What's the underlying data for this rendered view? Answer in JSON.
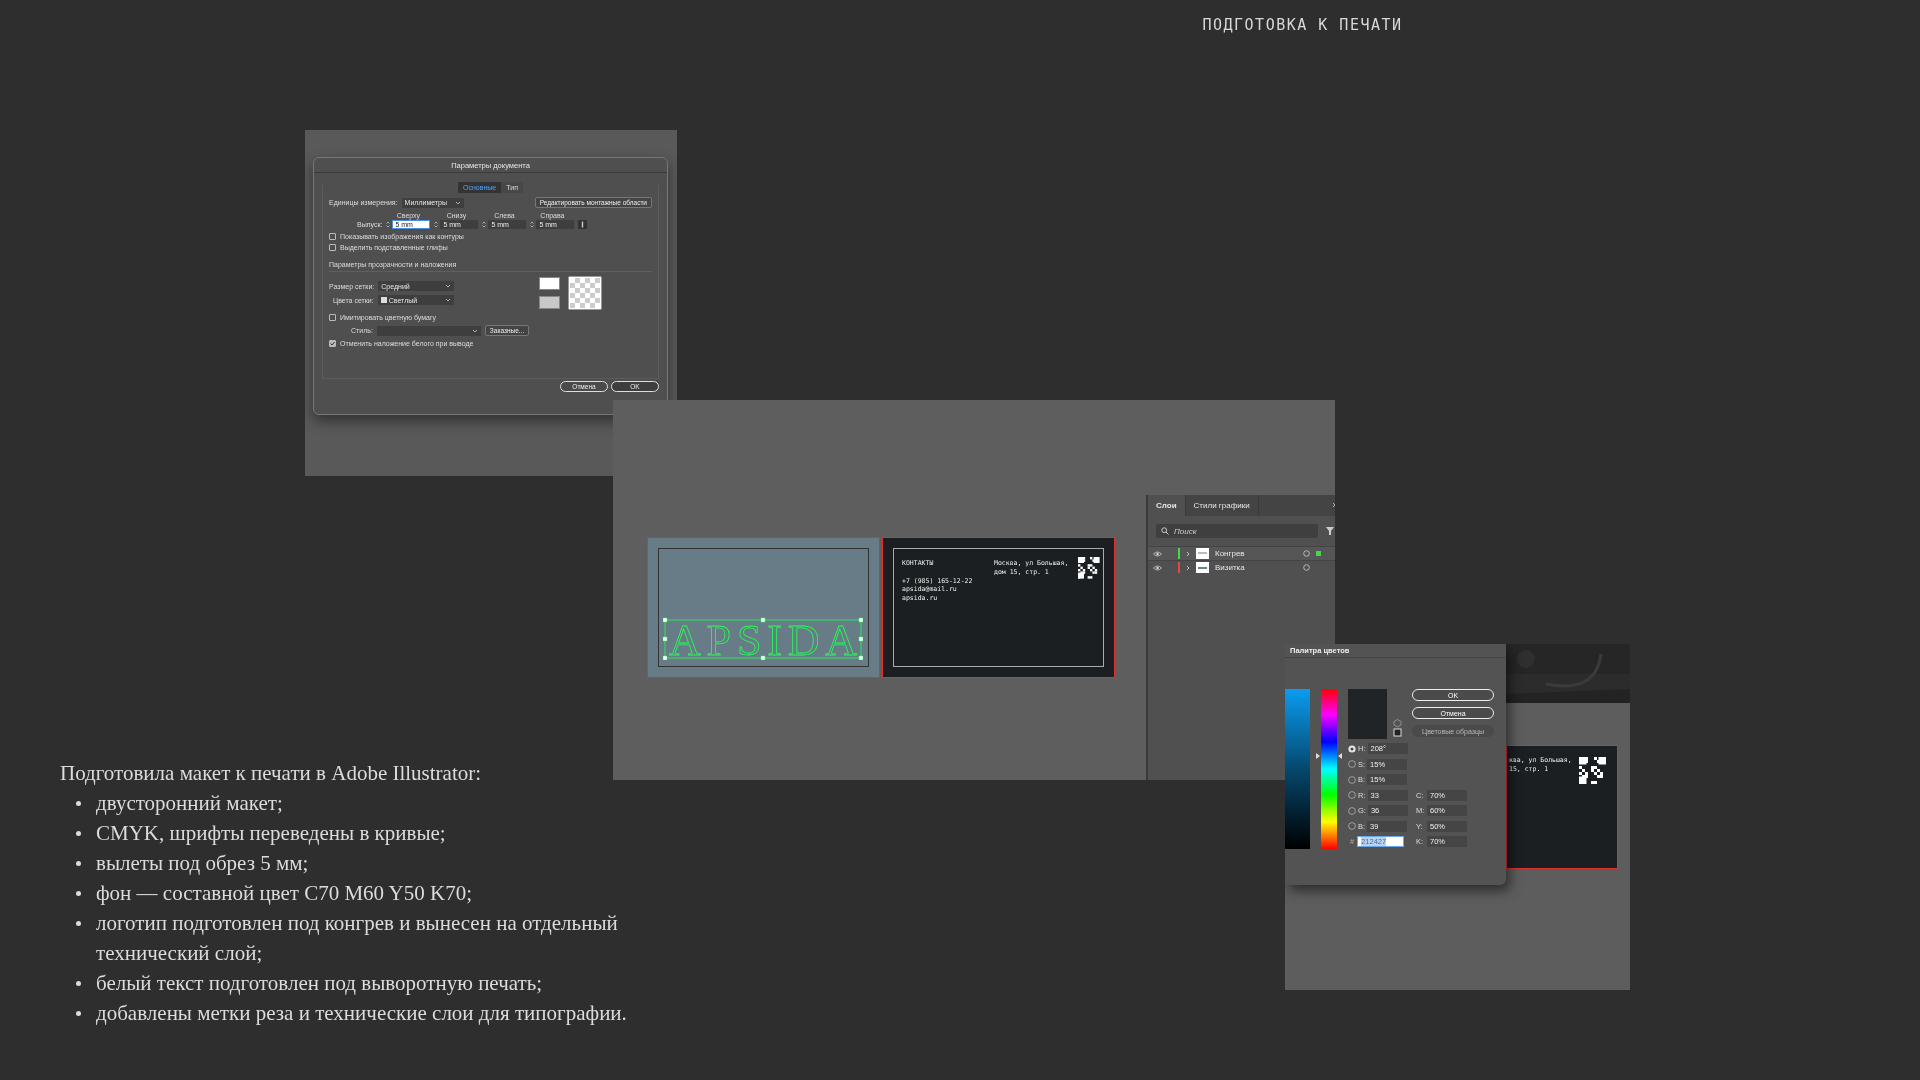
{
  "header": {
    "title": "ПОДГОТОВКА К ПЕЧАТИ"
  },
  "document_dialog": {
    "title": "Параметры документа",
    "tabs": [
      {
        "label": "Основные",
        "selected": true
      },
      {
        "label": "Тип",
        "selected": false
      }
    ],
    "units_label": "Единицы измерения:",
    "units_value": "Миллиметры",
    "edit_artboards_button": "Редактировать монтажные области",
    "bleed_label": "Выпуск:",
    "bleed": [
      {
        "label": "Сверху",
        "value": "5 mm",
        "focused": true
      },
      {
        "label": "Снизу",
        "value": "5 mm",
        "focused": false
      },
      {
        "label": "Слева",
        "value": "5 mm",
        "focused": false
      },
      {
        "label": "Справа",
        "value": "5 mm",
        "focused": false
      }
    ],
    "checkboxes": [
      {
        "label": "Показывать изображения как контуры",
        "checked": false
      },
      {
        "label": "Выделить подставленные глифы",
        "checked": false
      }
    ],
    "transparency_section": "Параметры прозрачности и наложения",
    "grid_size_label": "Размер сетки:",
    "grid_size_value": "Средний",
    "grid_colors_label": "Цвета сетки:",
    "grid_colors_value": "Светлый",
    "simulate_paper": {
      "label": "Имитировать цветную бумагу",
      "checked": false
    },
    "style_label": "Стиль:",
    "custom_button": "Заказные...",
    "discard_white": {
      "label": "Отменить наложение белого при выводе",
      "checked": true
    },
    "buttons": [
      "Отмена",
      "OK"
    ]
  },
  "artboards": {
    "logo_text": "APSIDA",
    "card": {
      "heading": "КОНТАКТЫ",
      "phone": "+7 (985) 165-12-22",
      "email": "apsida@mail.ru",
      "site": "apsida.ru",
      "address_lines": [
        "Москва, ул Большая,",
        "дом 15, стр. 1"
      ]
    }
  },
  "layers_panel": {
    "tabs": [
      {
        "label": "Слои",
        "selected": true
      },
      {
        "label": "Стили графики",
        "selected": false
      }
    ],
    "search": {
      "placeholder": "Поиск"
    },
    "layers": [
      {
        "name": "Конгрев",
        "color": "#3ddc4a",
        "selected": true
      },
      {
        "name": "Визитка",
        "color": "#e04848",
        "selected": false
      }
    ]
  },
  "color_picker": {
    "title": "Палитра цветов",
    "buttons": [
      "OK",
      "Отмена"
    ],
    "swatches_button": "Цветовые образцы",
    "fields": [
      {
        "label": "H:",
        "value": "208°",
        "selected": true
      },
      {
        "label": "S:",
        "value": "15%",
        "selected": false
      },
      {
        "label": "B:",
        "value": "15%",
        "selected": false
      },
      {
        "label": "R:",
        "value": "33",
        "selected": false
      },
      {
        "label": "G:",
        "value": "36",
        "selected": false
      },
      {
        "label": "B:",
        "value": "39",
        "selected": false
      }
    ],
    "cmyk": [
      {
        "label": "C:",
        "value": "70%"
      },
      {
        "label": "M:",
        "value": "60%"
      },
      {
        "label": "Y:",
        "value": "50%"
      },
      {
        "label": "K:",
        "value": "70%"
      }
    ],
    "hex_label": "#",
    "hex_value": "212427",
    "hue_slider": {
      "level": 0.58
    }
  },
  "partial_card": {
    "address_lines": [
      "ква, ул Большая,",
      "15, стр. 1"
    ]
  },
  "description": {
    "intro": "Подготовила макет к печати в Adobe Illustrator:",
    "items": [
      "двусторонний макет;",
      "CMYK, шрифты переведены в кривые;",
      "вылеты под обрез 5 мм;",
      "фон — составной цвет C70 M60 Y50 K70;",
      "логотип подготовлен под конгрев и вынесен на отдельный технический слой;",
      "белый текст подготовлен под выворотную печать;",
      "добавлены метки реза и технические слои для типографии."
    ]
  }
}
